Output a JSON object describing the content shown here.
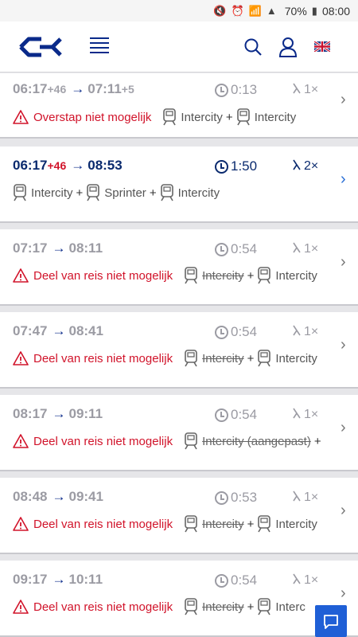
{
  "status_bar": {
    "battery": "70%",
    "time": "08:00"
  },
  "header": {
    "logo": "ns-logo",
    "menu_icon": "hamburger-menu-icon",
    "search_icon": "search-icon",
    "user_icon": "user-icon",
    "language_icon": "uk-flag-icon"
  },
  "colors": {
    "accent": "#0a2a8a",
    "warning": "#d1132a",
    "active_chevron": "#2a6fd6"
  },
  "trips": [
    {
      "depart": "06:17",
      "depart_delay": "+46",
      "arrive": "07:11",
      "arrive_delay": "+5",
      "duration": "0:13",
      "transfers": "1×",
      "warning": "Overstap niet mogelijk",
      "legs": [
        {
          "label": "Intercity",
          "cancelled": false
        },
        {
          "label": "Intercity",
          "cancelled": false
        }
      ],
      "disabled": true
    },
    {
      "depart": "06:17",
      "depart_delay": "+46",
      "arrive": "08:53",
      "arrive_delay": "",
      "duration": "1:50",
      "transfers": "2×",
      "warning": "",
      "legs": [
        {
          "label": "Intercity",
          "cancelled": false
        },
        {
          "label": "Sprinter",
          "cancelled": false
        },
        {
          "label": "Intercity",
          "cancelled": false
        }
      ],
      "disabled": false
    },
    {
      "depart": "07:17",
      "depart_delay": "",
      "arrive": "08:11",
      "arrive_delay": "",
      "duration": "0:54",
      "transfers": "1×",
      "warning": "Deel van reis niet mogelijk",
      "legs": [
        {
          "label": "Intercity",
          "cancelled": true
        },
        {
          "label": "Intercity",
          "cancelled": false
        }
      ],
      "disabled": true
    },
    {
      "depart": "07:47",
      "depart_delay": "",
      "arrive": "08:41",
      "arrive_delay": "",
      "duration": "0:54",
      "transfers": "1×",
      "warning": "Deel van reis niet mogelijk",
      "legs": [
        {
          "label": "Intercity",
          "cancelled": true
        },
        {
          "label": "Intercity",
          "cancelled": false
        }
      ],
      "disabled": true
    },
    {
      "depart": "08:17",
      "depart_delay": "",
      "arrive": "09:11",
      "arrive_delay": "",
      "duration": "0:54",
      "transfers": "1×",
      "warning": "Deel van reis niet mogelijk",
      "legs": [
        {
          "label": "Intercity (aangepast)",
          "cancelled": true
        }
      ],
      "trailing_plus": true,
      "disabled": true
    },
    {
      "depart": "08:48",
      "depart_delay": "",
      "arrive": "09:41",
      "arrive_delay": "",
      "duration": "0:53",
      "transfers": "1×",
      "warning": "Deel van reis niet mogelijk",
      "legs": [
        {
          "label": "Intercity",
          "cancelled": true
        },
        {
          "label": "Intercity",
          "cancelled": false
        }
      ],
      "disabled": true
    },
    {
      "depart": "09:17",
      "depart_delay": "",
      "arrive": "10:11",
      "arrive_delay": "",
      "duration": "0:54",
      "transfers": "1×",
      "warning": "Deel van reis niet mogelijk",
      "legs": [
        {
          "label": "Intercity",
          "cancelled": true
        },
        {
          "label": "Interc",
          "cancelled": false
        }
      ],
      "disabled": true
    }
  ],
  "chat_icon": "chat-icon"
}
